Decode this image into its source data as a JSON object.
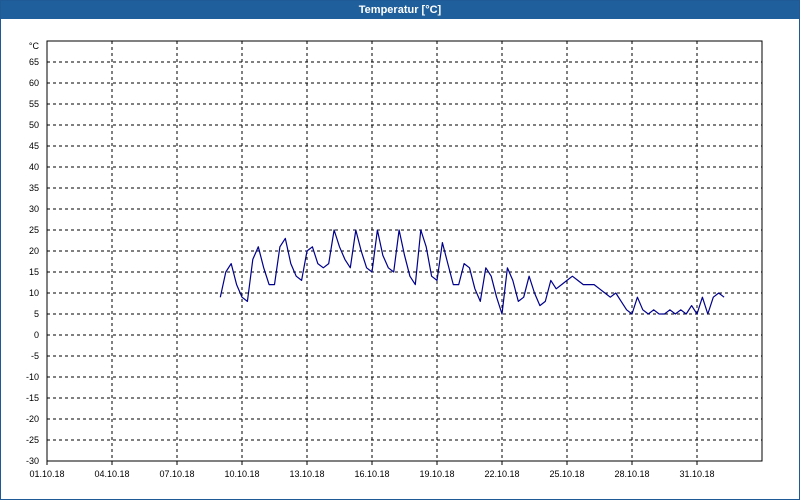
{
  "window": {
    "title": "Temperatur [°C]"
  },
  "colors": {
    "titlebar": "#1f5f9c",
    "line": "#00008b",
    "grid": "#000000",
    "background": "#ffffff"
  },
  "chart_data": {
    "type": "line",
    "title": "Temperatur [°C]",
    "ylabel": "°C",
    "xlabel": "",
    "ylim": [
      -30,
      70
    ],
    "xlim": [
      "01.10.18",
      "03.11.18"
    ],
    "y_ticks": [
      65,
      60,
      55,
      50,
      45,
      40,
      35,
      30,
      25,
      20,
      15,
      10,
      5,
      0,
      -5,
      -10,
      -15,
      -20,
      -25,
      -30
    ],
    "x_ticks": [
      "01.10.18",
      "04.10.18",
      "07.10.18",
      "10.10.18",
      "13.10.18",
      "16.10.18",
      "19.10.18",
      "22.10.18",
      "25.10.18",
      "28.10.18",
      "31.10.18"
    ],
    "grid": true,
    "legend": "none",
    "series": [
      {
        "color": "#00008b",
        "x": [
          "09.10.18 00:00",
          "09.10.18 06:00",
          "09.10.18 12:00",
          "09.10.18 18:00",
          "10.10.18 00:00",
          "10.10.18 06:00",
          "10.10.18 12:00",
          "10.10.18 18:00",
          "11.10.18 00:00",
          "11.10.18 06:00",
          "11.10.18 12:00",
          "11.10.18 18:00",
          "12.10.18 00:00",
          "12.10.18 06:00",
          "12.10.18 12:00",
          "12.10.18 18:00",
          "13.10.18 00:00",
          "13.10.18 06:00",
          "13.10.18 12:00",
          "13.10.18 18:00",
          "14.10.18 00:00",
          "14.10.18 06:00",
          "14.10.18 12:00",
          "14.10.18 18:00",
          "15.10.18 00:00",
          "15.10.18 06:00",
          "15.10.18 12:00",
          "15.10.18 18:00",
          "16.10.18 00:00",
          "16.10.18 06:00",
          "16.10.18 12:00",
          "16.10.18 18:00",
          "17.10.18 00:00",
          "17.10.18 06:00",
          "17.10.18 12:00",
          "17.10.18 18:00",
          "18.10.18 00:00",
          "18.10.18 06:00",
          "18.10.18 12:00",
          "18.10.18 18:00",
          "19.10.18 00:00",
          "19.10.18 06:00",
          "19.10.18 12:00",
          "19.10.18 18:00",
          "20.10.18 00:00",
          "20.10.18 06:00",
          "20.10.18 12:00",
          "20.10.18 18:00",
          "21.10.18 00:00",
          "21.10.18 06:00",
          "21.10.18 12:00",
          "21.10.18 18:00",
          "22.10.18 00:00",
          "22.10.18 06:00",
          "22.10.18 12:00",
          "22.10.18 18:00",
          "23.10.18 00:00",
          "23.10.18 06:00",
          "23.10.18 12:00",
          "23.10.18 18:00",
          "24.10.18 00:00",
          "24.10.18 06:00",
          "24.10.18 12:00",
          "24.10.18 18:00",
          "25.10.18 00:00",
          "25.10.18 06:00",
          "25.10.18 12:00",
          "25.10.18 18:00",
          "26.10.18 00:00",
          "26.10.18 06:00",
          "26.10.18 12:00",
          "26.10.18 18:00",
          "27.10.18 00:00",
          "27.10.18 06:00",
          "27.10.18 12:00",
          "27.10.18 18:00",
          "28.10.18 00:00",
          "28.10.18 06:00",
          "28.10.18 12:00",
          "28.10.18 18:00",
          "29.10.18 00:00",
          "29.10.18 06:00",
          "29.10.18 12:00",
          "29.10.18 18:00",
          "30.10.18 00:00",
          "30.10.18 06:00",
          "30.10.18 12:00",
          "30.10.18 18:00",
          "31.10.18 00:00",
          "31.10.18 06:00",
          "31.10.18 12:00",
          "31.10.18 18:00",
          "01.11.18 00:00",
          "01.11.18 06:00",
          "01.11.18 12:00",
          "01.11.18 18:00",
          "02.11.18 00:00"
        ],
        "y": [
          9,
          15,
          17,
          12,
          9,
          8,
          18,
          21,
          16,
          12,
          12,
          21,
          23,
          17,
          14,
          13,
          20,
          21,
          17,
          16,
          17,
          25,
          21,
          18,
          16,
          25,
          20,
          16,
          15,
          25,
          19,
          16,
          15,
          25,
          19,
          14,
          12,
          25,
          21,
          14,
          13,
          22,
          17,
          12,
          12,
          17,
          16,
          11,
          8,
          16,
          14,
          9,
          5,
          16,
          13,
          8,
          9,
          14,
          10,
          7,
          8,
          13,
          11,
          12,
          13,
          14,
          13,
          12,
          12,
          12,
          11,
          10,
          9,
          10,
          8,
          6,
          5,
          9,
          6,
          5,
          6,
          5,
          5,
          6,
          5,
          6,
          5,
          7,
          5,
          9,
          5,
          9,
          10,
          9,
          null,
          null,
          null
        ]
      }
    ]
  }
}
